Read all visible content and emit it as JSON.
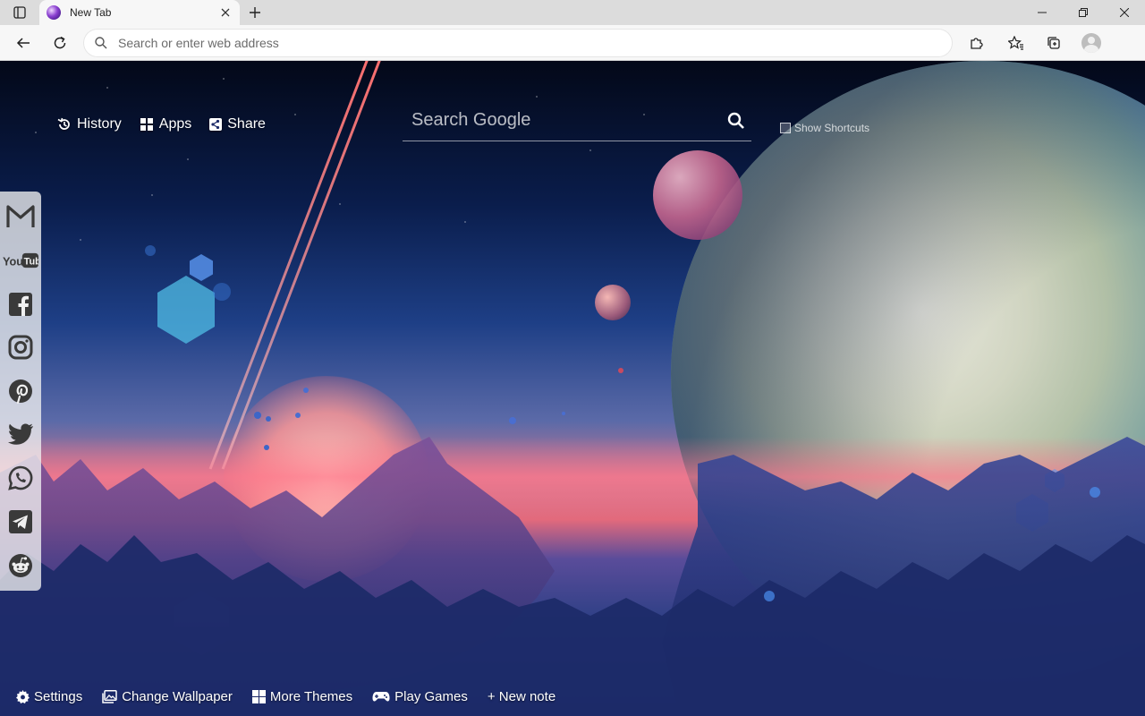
{
  "browser": {
    "tab": {
      "title": "New Tab"
    },
    "address_bar": {
      "placeholder": "Search or enter web address",
      "value": ""
    }
  },
  "page": {
    "nav": [
      {
        "label": "History",
        "icon": "history-icon"
      },
      {
        "label": "Apps",
        "icon": "grid-icon"
      },
      {
        "label": "Share",
        "icon": "share-icon"
      }
    ],
    "search": {
      "placeholder": "Search Google",
      "value": ""
    },
    "show_shortcuts": {
      "label": "Show Shortcuts",
      "checked": false
    },
    "social": [
      "gmail-icon",
      "youtube-icon",
      "facebook-icon",
      "instagram-icon",
      "pinterest-icon",
      "twitter-icon",
      "whatsapp-icon",
      "telegram-icon",
      "reddit-icon"
    ],
    "bottom": [
      {
        "label": "Settings",
        "icon": "gear-icon"
      },
      {
        "label": "Change Wallpaper",
        "icon": "image-icon"
      },
      {
        "label": "More Themes",
        "icon": "windows-icon"
      },
      {
        "label": "Play Games",
        "icon": "gamepad-icon"
      },
      {
        "label": "+ New note",
        "icon": ""
      }
    ]
  },
  "colors": {
    "chrome_bg": "#dcdcdc",
    "toolbar_bg": "#f7f7f7",
    "social_bar": "#f0f0f0",
    "text_on_wallpaper": "#ffffff"
  }
}
